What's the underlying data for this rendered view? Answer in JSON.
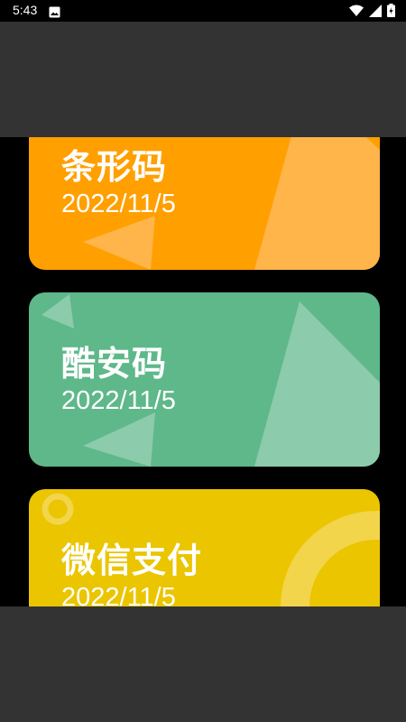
{
  "status_bar": {
    "time": "5:43",
    "icons": [
      "image-icon",
      "wifi-icon",
      "signal-icon",
      "battery-icon"
    ]
  },
  "cards": [
    {
      "title": "条形码",
      "date": "2022/11/5",
      "color": "#FF9F00"
    },
    {
      "title": "酷安码",
      "date": "2022/11/5",
      "color": "#5EB88A"
    },
    {
      "title": "微信支付",
      "date": "2022/11/5",
      "color": "#EAC500"
    }
  ],
  "colors": {
    "panel": "#333333",
    "background": "#000000"
  }
}
